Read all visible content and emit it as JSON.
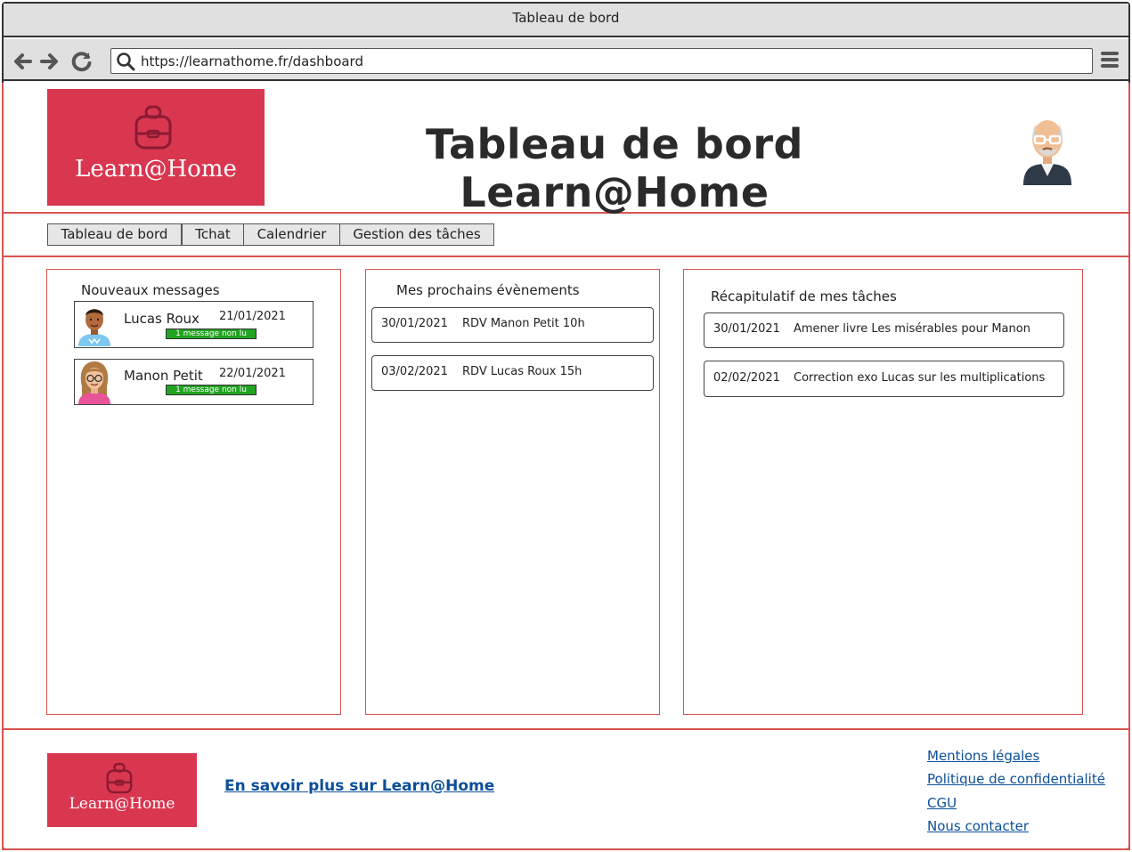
{
  "window": {
    "title": "Tableau de bord"
  },
  "browser": {
    "url": "https://learnathome.fr/dashboard"
  },
  "header": {
    "logo_text": "Learn@Home",
    "title": "Tableau de bord Learn@Home"
  },
  "nav": {
    "tabs": [
      {
        "label": "Tableau de bord"
      },
      {
        "label": "Tchat"
      },
      {
        "label": "Calendrier"
      },
      {
        "label": "Gestion des tâches"
      }
    ]
  },
  "messages": {
    "title": "Nouveaux messages",
    "items": [
      {
        "name": "Lucas Roux",
        "date": "21/01/2021",
        "badge": "1 message non lu"
      },
      {
        "name": "Manon Petit",
        "date": "22/01/2021",
        "badge": "1 message non lu"
      }
    ]
  },
  "events": {
    "title": "Mes prochains évènements",
    "items": [
      {
        "date": "30/01/2021",
        "label": "RDV Manon Petit 10h"
      },
      {
        "date": "03/02/2021",
        "label": "RDV Lucas Roux 15h"
      }
    ]
  },
  "tasks": {
    "title": "Récapitulatif de mes tâches",
    "items": [
      {
        "date": "30/01/2021",
        "label": "Amener livre Les misérables pour Manon"
      },
      {
        "date": "02/02/2021",
        "label": "Correction exo Lucas sur les multiplications"
      }
    ]
  },
  "footer": {
    "logo_text": "Learn@Home",
    "about_link": "En savoir plus sur Learn@Home",
    "links": [
      {
        "label": "Mentions légales"
      },
      {
        "label": "Politique de confidentialité"
      },
      {
        "label": "CGU"
      },
      {
        "label": "Nous contacter"
      }
    ]
  },
  "colors": {
    "brand": "#d93650",
    "frame": "#d9534f",
    "link": "#0b4f99",
    "badge": "#22a322"
  }
}
